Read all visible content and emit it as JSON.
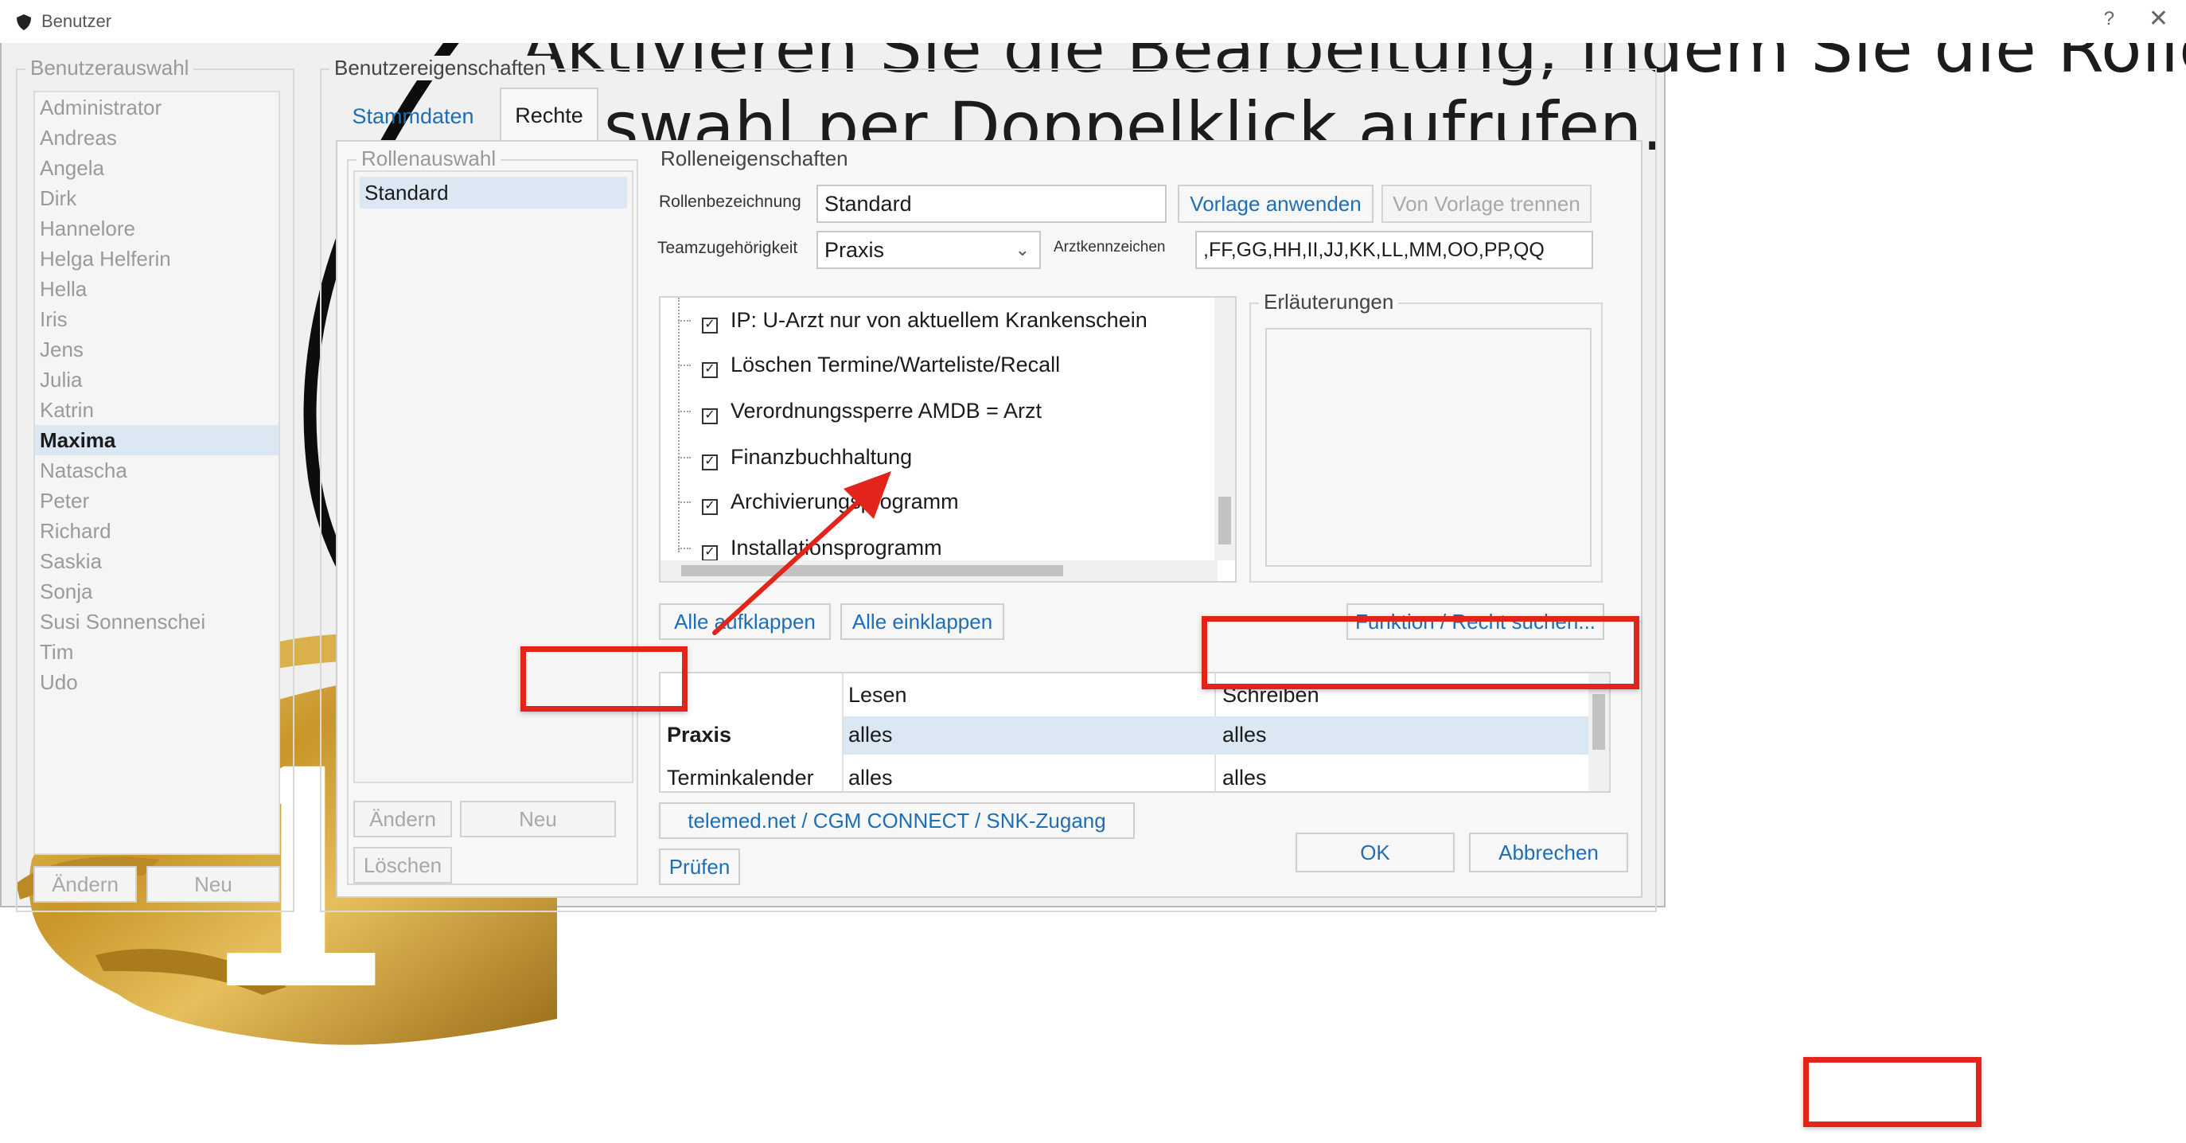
{
  "headline": {
    "line1": "Aktivieren Sie die Bearbeitung, indem Sie die Rollen-",
    "line2": "auswahl per Doppelklick aufrufen."
  },
  "step_number": "1",
  "colors": {
    "annotation_red": "#e3241b",
    "link_blue": "#1e6eb6",
    "selection": "#dbe7f3",
    "gold": "#c79a2a"
  },
  "dialog": {
    "title": "Benutzer",
    "help": "?",
    "close": "✕",
    "user_group": {
      "label": "Benutzerauswahl",
      "users": [
        "Administrator",
        "Andreas",
        "Angela",
        "Dirk",
        "Hannelore",
        "Helga Helferin",
        "Hella",
        "Iris",
        "Jens",
        "Julia",
        "Katrin",
        "Maxima",
        "Natascha",
        "Peter",
        "Richard",
        "Saskia",
        "Sonja",
        "Susi Sonnenschei",
        "Tim",
        "Udo"
      ],
      "selected_user": "Maxima",
      "edit_button": "Ändern",
      "new_button": "Neu"
    },
    "properties": {
      "label": "Benutzereigenschaften",
      "tabs": [
        "Stammdaten",
        "Rechte"
      ],
      "active_tab": "Rechte",
      "roles_group": {
        "label": "Rollenauswahl",
        "roles": [
          "Standard"
        ],
        "edit_button": "Ändern",
        "new_button": "Neu",
        "delete_button": "Löschen"
      },
      "role_props": {
        "label": "Rolleneigenschaften",
        "name_label": "Rollenbezeichnung",
        "name_value": "Standard",
        "apply_template": "Vorlage anwenden",
        "detach_template": "Von Vorlage trennen",
        "team_label": "Teamzugehörigkeit",
        "team_value": "Praxis",
        "doctor_code_label": "Arztkennzeichen",
        "doctor_code_value": ",FF,GG,HH,II,JJ,KK,LL,MM,OO,PP,QQ",
        "tree_items": [
          "IP: U-Arzt nur von aktuellem Krankenschein",
          "Löschen Termine/Warteliste/Recall",
          "Verordnungssperre AMDB = Arzt",
          "Finanzbuchhaltung",
          "Archivierungsprogramm",
          "Installationsprogramm"
        ],
        "explanations_label": "Erläuterungen",
        "expand_all": "Alle aufklappen",
        "collapse_all": "Alle einklappen",
        "search_function": "Funktion / Recht suchen...",
        "table": {
          "headers": [
            "",
            "Lesen",
            "Schreiben"
          ],
          "rows": [
            [
              "Praxis",
              "alles",
              "alles"
            ],
            [
              "Terminkalender",
              "alles",
              "alles"
            ]
          ]
        },
        "telemed_button": "telemed.net / CGM CONNECT / SNK-Zugang",
        "check_button": "Prüfen"
      }
    },
    "ok_button": "OK",
    "cancel_button": "Abbrechen"
  }
}
